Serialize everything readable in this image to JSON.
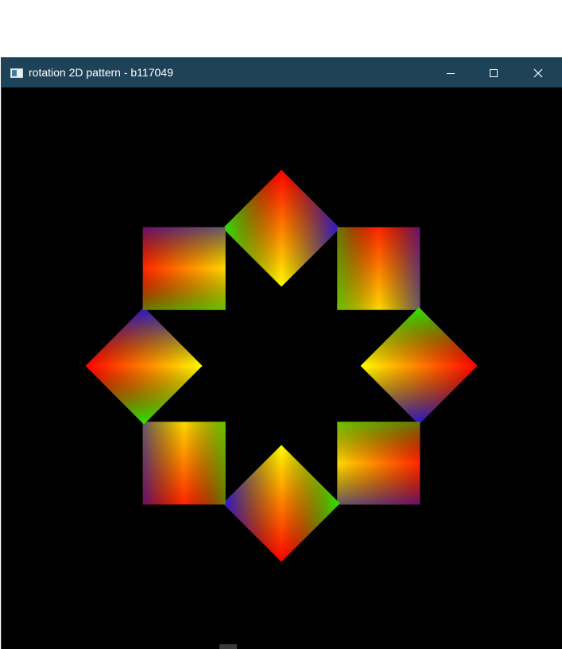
{
  "window": {
    "title": "rotation 2D pattern - b117049"
  },
  "titlebar_controls": {
    "minimize_icon": "minimize-icon",
    "maximize_icon": "maximize-icon",
    "close_icon": "close-icon"
  },
  "colors": {
    "titlebar": "#1e4257",
    "canvas_background": "#000000",
    "gradient_colors": [
      "#ff0000",
      "#00ff00",
      "#0000ff",
      "#ffff00"
    ]
  },
  "pattern": {
    "shape_count": 8,
    "rotation_step_degrees": 45
  }
}
